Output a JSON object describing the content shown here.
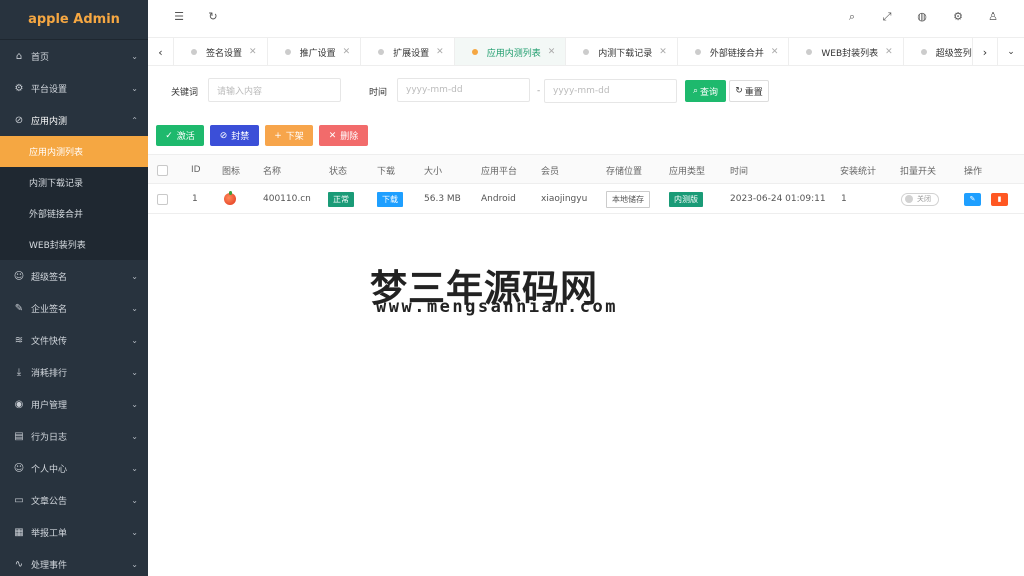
{
  "brand": "apple Admin",
  "sidebar": {
    "items": [
      {
        "label": "首页",
        "icon": "home-icon"
      },
      {
        "label": "平台设置",
        "icon": "gear-icon"
      },
      {
        "label": "应用内测",
        "icon": "paperclip-icon",
        "open": true
      },
      {
        "label": "超级签名",
        "icon": "smile-icon"
      },
      {
        "label": "企业签名",
        "icon": "edit-icon"
      },
      {
        "label": "文件快传",
        "icon": "layers-icon"
      },
      {
        "label": "消耗排行",
        "icon": "download-icon"
      },
      {
        "label": "用户管理",
        "icon": "user-circle-icon"
      },
      {
        "label": "行为日志",
        "icon": "document-icon"
      },
      {
        "label": "个人中心",
        "icon": "smile-icon"
      },
      {
        "label": "文章公告",
        "icon": "monitor-icon"
      },
      {
        "label": "举报工单",
        "icon": "calendar-icon"
      },
      {
        "label": "处理事件",
        "icon": "activity-icon"
      }
    ],
    "submenu": [
      {
        "label": "应用内测列表",
        "active": true
      },
      {
        "label": "内测下载记录"
      },
      {
        "label": "外部链接合并"
      },
      {
        "label": "WEB封装列表"
      }
    ]
  },
  "tabs": [
    {
      "label": "签名设置"
    },
    {
      "label": "推广设置"
    },
    {
      "label": "扩展设置"
    },
    {
      "label": "应用内测列表",
      "active": true
    },
    {
      "label": "内测下载记录"
    },
    {
      "label": "外部链接合并"
    },
    {
      "label": "WEB封装列表"
    },
    {
      "label": "超级签列表"
    }
  ],
  "search": {
    "keyword_label": "关键词",
    "keyword_placeholder": "请输入内容",
    "time_label": "时间",
    "date_placeholder": "yyyy-mm-dd",
    "dash": "-",
    "search_btn": "查询",
    "reset_btn": "重置"
  },
  "actions": {
    "activate": "激活",
    "ban": "封禁",
    "offline": "下架",
    "delete": "删除"
  },
  "table": {
    "headers": [
      "ID",
      "图标",
      "名称",
      "状态",
      "下载",
      "大小",
      "应用平台",
      "会员",
      "存储位置",
      "应用类型",
      "时间",
      "安装统计",
      "扣量开关",
      "操作"
    ],
    "rows": [
      {
        "id": "1",
        "name": "400110.cn",
        "status": "正常",
        "download": "下载",
        "size": "56.3 MB",
        "platform": "Android",
        "member": "xiaojingyu",
        "storage": "本地储存",
        "type": "内测版",
        "time": "2023-06-24 01:09:11",
        "installs": "1",
        "switch": "关闭"
      }
    ]
  },
  "watermark": {
    "title": "梦三年源码网",
    "url": "www.mengsannian.com"
  },
  "colors": {
    "sidebar_bg": "#28333e",
    "accent": "#f5a742",
    "green": "#1eb96d",
    "blue": "#3b5bdb",
    "orange": "#f7a54b",
    "red": "#f26b6b"
  }
}
